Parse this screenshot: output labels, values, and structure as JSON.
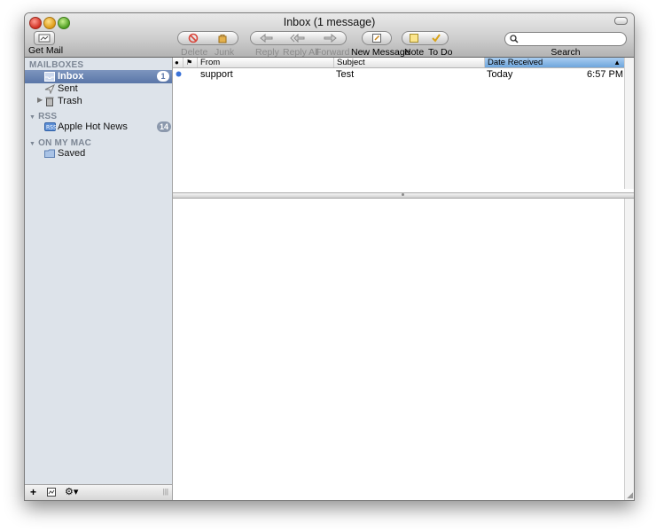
{
  "window": {
    "title": "Inbox (1 message)"
  },
  "toolbar": {
    "get_mail": "Get Mail",
    "delete": "Delete",
    "junk": "Junk",
    "reply": "Reply",
    "reply_all": "Reply All",
    "forward": "Forward",
    "new_message": "New Message",
    "note": "Note",
    "todo": "To Do",
    "search_label": "Search",
    "search_value": ""
  },
  "sidebar": {
    "mailboxes_header": "MAILBOXES",
    "inbox_label": "Inbox",
    "inbox_badge": "1",
    "sent_label": "Sent",
    "trash_label": "Trash",
    "rss_header": "RSS",
    "rss_feed_label": "Apple Hot News",
    "rss_feed_badge": "14",
    "on_my_mac_header": "ON MY MAC",
    "saved_label": "Saved"
  },
  "message_list": {
    "columns": {
      "status": "●",
      "flag": "⚑",
      "from": "From",
      "subject": "Subject",
      "date_received": "Date Received",
      "sort_indicator": "▲"
    },
    "messages": [
      {
        "from": "support",
        "subject": "Test",
        "date": "Today",
        "time": "6:57 PM",
        "unread": true
      }
    ]
  },
  "colors": {
    "selection": "#5a76a8",
    "sidebar_bg": "#dde3ea",
    "unread_dot": "#3b73d8",
    "sorted_column": "#6ea5dc"
  }
}
